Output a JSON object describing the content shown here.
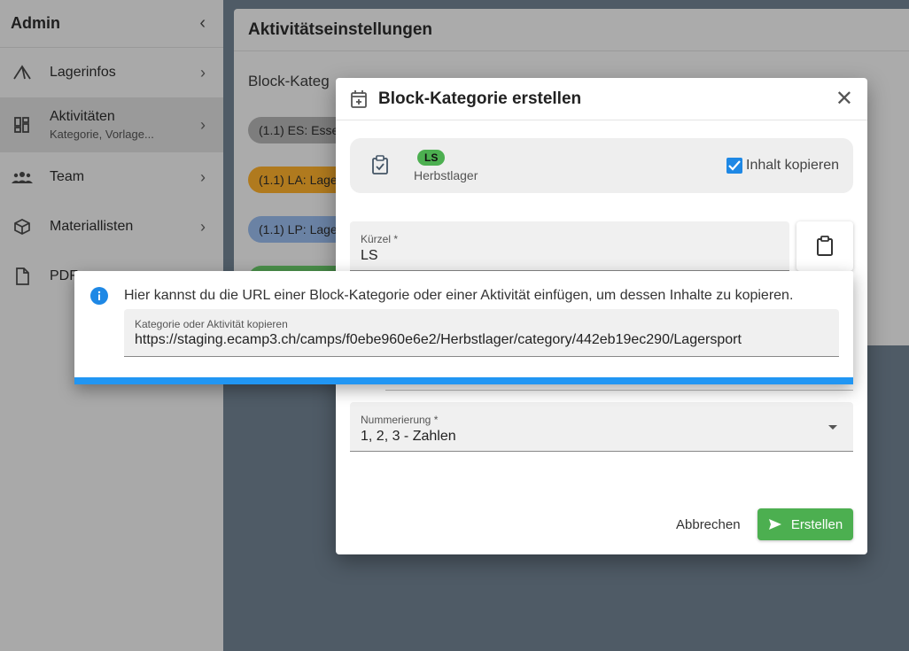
{
  "sidebar": {
    "title": "Admin",
    "items": [
      {
        "label": "Lagerinfos",
        "sub": ""
      },
      {
        "label": "Aktivitäten",
        "sub": "Kategorie, Vorlage..."
      },
      {
        "label": "Team",
        "sub": ""
      },
      {
        "label": "Materiallisten",
        "sub": ""
      },
      {
        "label": "PDF",
        "sub": ""
      }
    ]
  },
  "main": {
    "title": "Aktivitätseinstellungen",
    "column_header": "Block-Kateg",
    "chips": [
      "(1.1) ES: Esse",
      "(1.1) LA: Lage",
      "(1.1) LP: Lage"
    ]
  },
  "dialog": {
    "title": "Block-Kategorie erstellen",
    "copy_source": {
      "short": "LS",
      "camp": "Herbstlager",
      "checkbox_label": "Inhalt kopieren"
    },
    "kuerzel_label": "Kürzel *",
    "kuerzel_value": "LS",
    "numbering_label": "Nummerierung *",
    "numbering_value": "1, 2, 3 - Zahlen",
    "cancel_label": "Abbrechen",
    "create_label": "Erstellen"
  },
  "popup": {
    "message": "Hier kannst du die URL einer Block-Kategorie oder einer Aktivität einfügen, um dessen Inhalte zu kopieren.",
    "field_label": "Kategorie oder Aktivität kopieren",
    "field_value": "https://staging.ecamp3.ch/camps/f0ebe960e6e2/Herbstlager/category/442eb19ec290/Lagersport"
  },
  "colors": {
    "accent": "#2196f3",
    "success": "#4caf50"
  }
}
